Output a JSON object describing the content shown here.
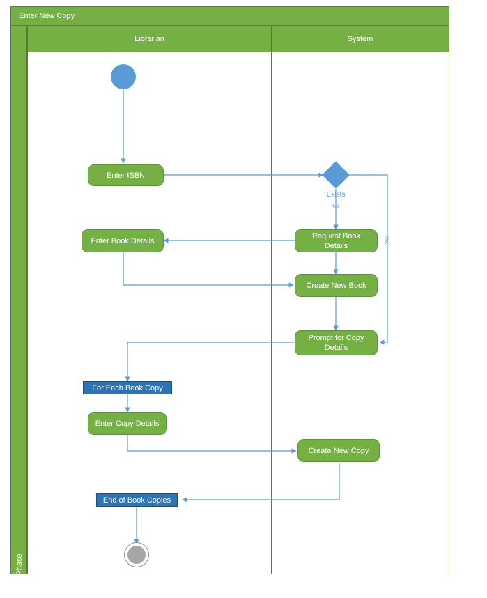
{
  "diagram": {
    "title": "Enter New Copy",
    "phase_label": "Phase",
    "accent_green": "#74b043",
    "accent_blue": "#2e74b5",
    "node_blue": "#5b9bd5",
    "edge_color": "#5b9bd5",
    "border_green": "#5a7a30",
    "end_node_gray": "#a6a6a6"
  },
  "lanes": [
    {
      "name": "librarian",
      "label": "Librarian"
    },
    {
      "name": "system",
      "label": "System"
    }
  ],
  "nodes": {
    "start": {
      "label": "",
      "type": "start-node"
    },
    "enter_isbn": {
      "label": "Enter ISBN",
      "type": "activity",
      "lane": "librarian"
    },
    "exists_decision": {
      "label": "Exists",
      "type": "decision",
      "lane": "system"
    },
    "enter_book_details": {
      "label": "Enter Book Details",
      "type": "activity",
      "lane": "librarian"
    },
    "request_book_details": {
      "label": "Request Book Details",
      "type": "activity",
      "lane": "system"
    },
    "create_new_book": {
      "label": "Create New Book",
      "type": "activity",
      "lane": "system"
    },
    "prompt_for_copy_details": {
      "label": "Prompt for Copy Details",
      "type": "activity",
      "lane": "system"
    },
    "for_each_book_copy": {
      "label": "For Each Book Copy",
      "type": "loopbar",
      "lane": "librarian"
    },
    "enter_copy_details": {
      "label": "Enter Copy Details",
      "type": "activity",
      "lane": "librarian"
    },
    "create_new_copy": {
      "label": "Create New Copy",
      "type": "activity",
      "lane": "system"
    },
    "end_of_book_copies": {
      "label": "End of Book Copies",
      "type": "loopbar",
      "lane": "librarian"
    },
    "end": {
      "label": "",
      "type": "end-node"
    }
  },
  "edge_labels": {
    "decision_name": "Exists",
    "branch_no": "No",
    "branch_yes": "Yes"
  }
}
